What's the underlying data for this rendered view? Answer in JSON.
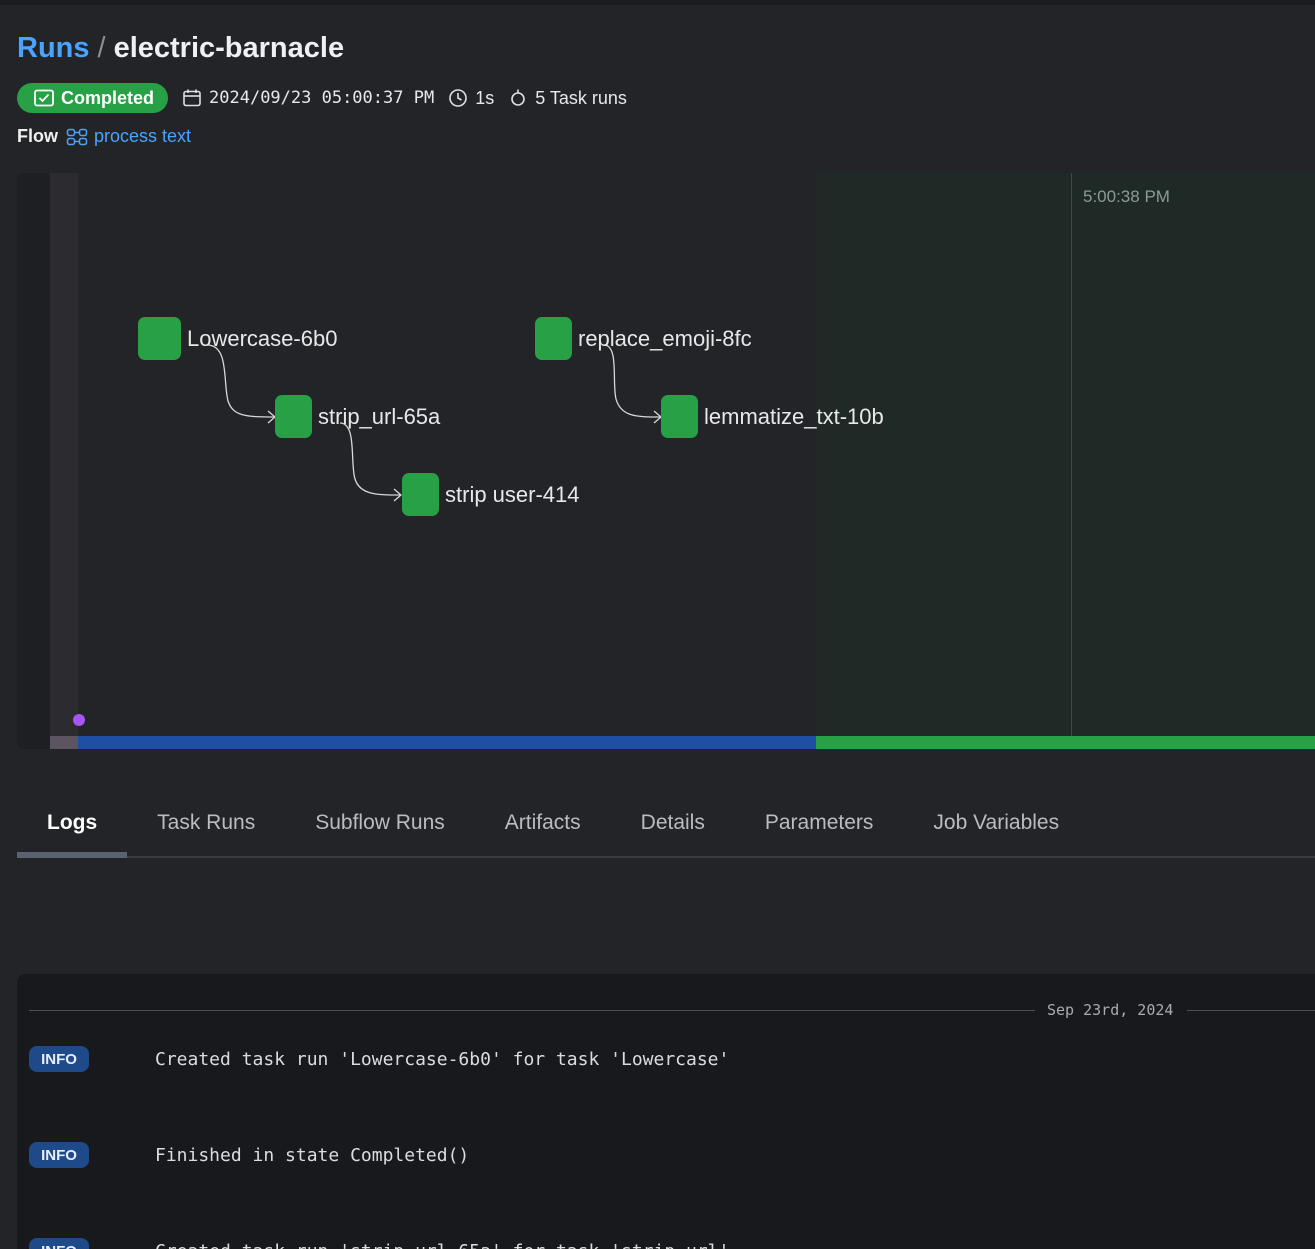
{
  "header": {
    "breadcrumb_root": "Runs",
    "breadcrumb_sep": "/",
    "run_name": "electric-barnacle"
  },
  "meta": {
    "status": "Completed",
    "start_time": "2024/09/23 05:00:37 PM",
    "duration": "1s",
    "task_runs": "5 Task runs"
  },
  "flow": {
    "label": "Flow",
    "name": "process text"
  },
  "graph": {
    "time_label": "5:00:38 PM",
    "nodes": [
      {
        "label": "Lowercase-6b0"
      },
      {
        "label": "strip_url-65a"
      },
      {
        "label": "strip user-414"
      },
      {
        "label": "replace_emoji-8fc"
      },
      {
        "label": "lemmatize_txt-10b"
      }
    ],
    "colors": {
      "node": "#27a046",
      "running_bar": "#1f4fa3",
      "completed_bar": "#27a046",
      "marker": "#a855f7"
    }
  },
  "tabs": [
    {
      "label": "Logs",
      "active": true
    },
    {
      "label": "Task Runs"
    },
    {
      "label": "Subflow Runs"
    },
    {
      "label": "Artifacts"
    },
    {
      "label": "Details"
    },
    {
      "label": "Parameters"
    },
    {
      "label": "Job Variables"
    }
  ],
  "logs": {
    "date": "Sep 23rd, 2024",
    "entries": [
      {
        "level": "INFO",
        "message": "Created task run 'Lowercase-6b0' for task 'Lowercase'"
      },
      {
        "level": "INFO",
        "message": "Finished in state Completed()"
      },
      {
        "level": "INFO",
        "message": "Created task run 'strip_url-65a' for task 'strip_url'"
      }
    ]
  }
}
